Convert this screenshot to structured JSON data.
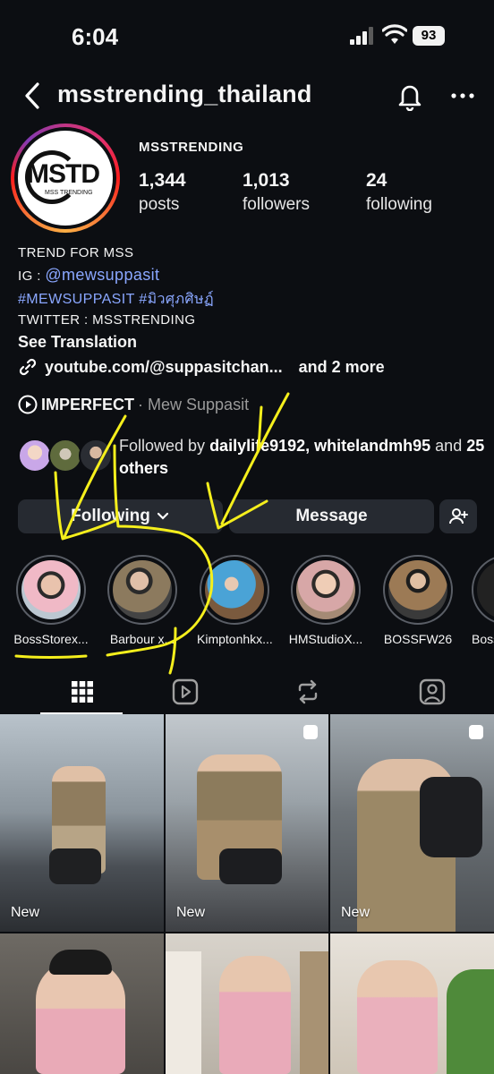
{
  "status_bar": {
    "time": "6:04",
    "battery": "93"
  },
  "header": {
    "username": "msstrending_thailand"
  },
  "profile": {
    "display_name": "MSSTRENDING",
    "avatar_text": "MSTD",
    "avatar_sub": "MSS TRENDING",
    "stats": [
      {
        "value": "1,344",
        "label": "posts"
      },
      {
        "value": "1,013",
        "label": "followers"
      },
      {
        "value": "24",
        "label": "following"
      }
    ]
  },
  "bio": {
    "line1": "TREND FOR MSS",
    "ig_prefix": "IG : ",
    "ig_handle": "@mewsuppasit",
    "hashtags": "#MEWSUPPASIT #มิวศุภศิษฏ์",
    "twitter": "TWITTER : MSSTRENDING",
    "see_translation": "See Translation",
    "link": "youtube.com/@suppasitchan...",
    "link_more": "and 2 more",
    "music_title": "IMPERFECT",
    "music_artist": "· Mew Suppasit"
  },
  "followed_by": {
    "prefix": "Followed by ",
    "names": "dailylife9192, whitelandmh95",
    "mid": " and ",
    "others": "25 others"
  },
  "buttons": {
    "following": "Following",
    "message": "Message"
  },
  "highlights": [
    {
      "label": "BossStorex..."
    },
    {
      "label": "Barbour x..."
    },
    {
      "label": "Kimptonhkx..."
    },
    {
      "label": "HMStudioX..."
    },
    {
      "label": "BOSSFW26"
    },
    {
      "label": "Boss"
    }
  ],
  "tabs": [
    "grid-icon",
    "reels-icon",
    "reposts-icon",
    "tagged-icon"
  ],
  "posts": [
    {
      "badge": "New"
    },
    {
      "badge": "New"
    },
    {
      "badge": "New"
    },
    {
      "badge": ""
    },
    {
      "badge": ""
    },
    {
      "badge": ""
    }
  ],
  "colors": {
    "background": "#0c0e12",
    "link": "#8aa7ff",
    "button": "#262a31",
    "annotation": "#f5ef1c"
  }
}
